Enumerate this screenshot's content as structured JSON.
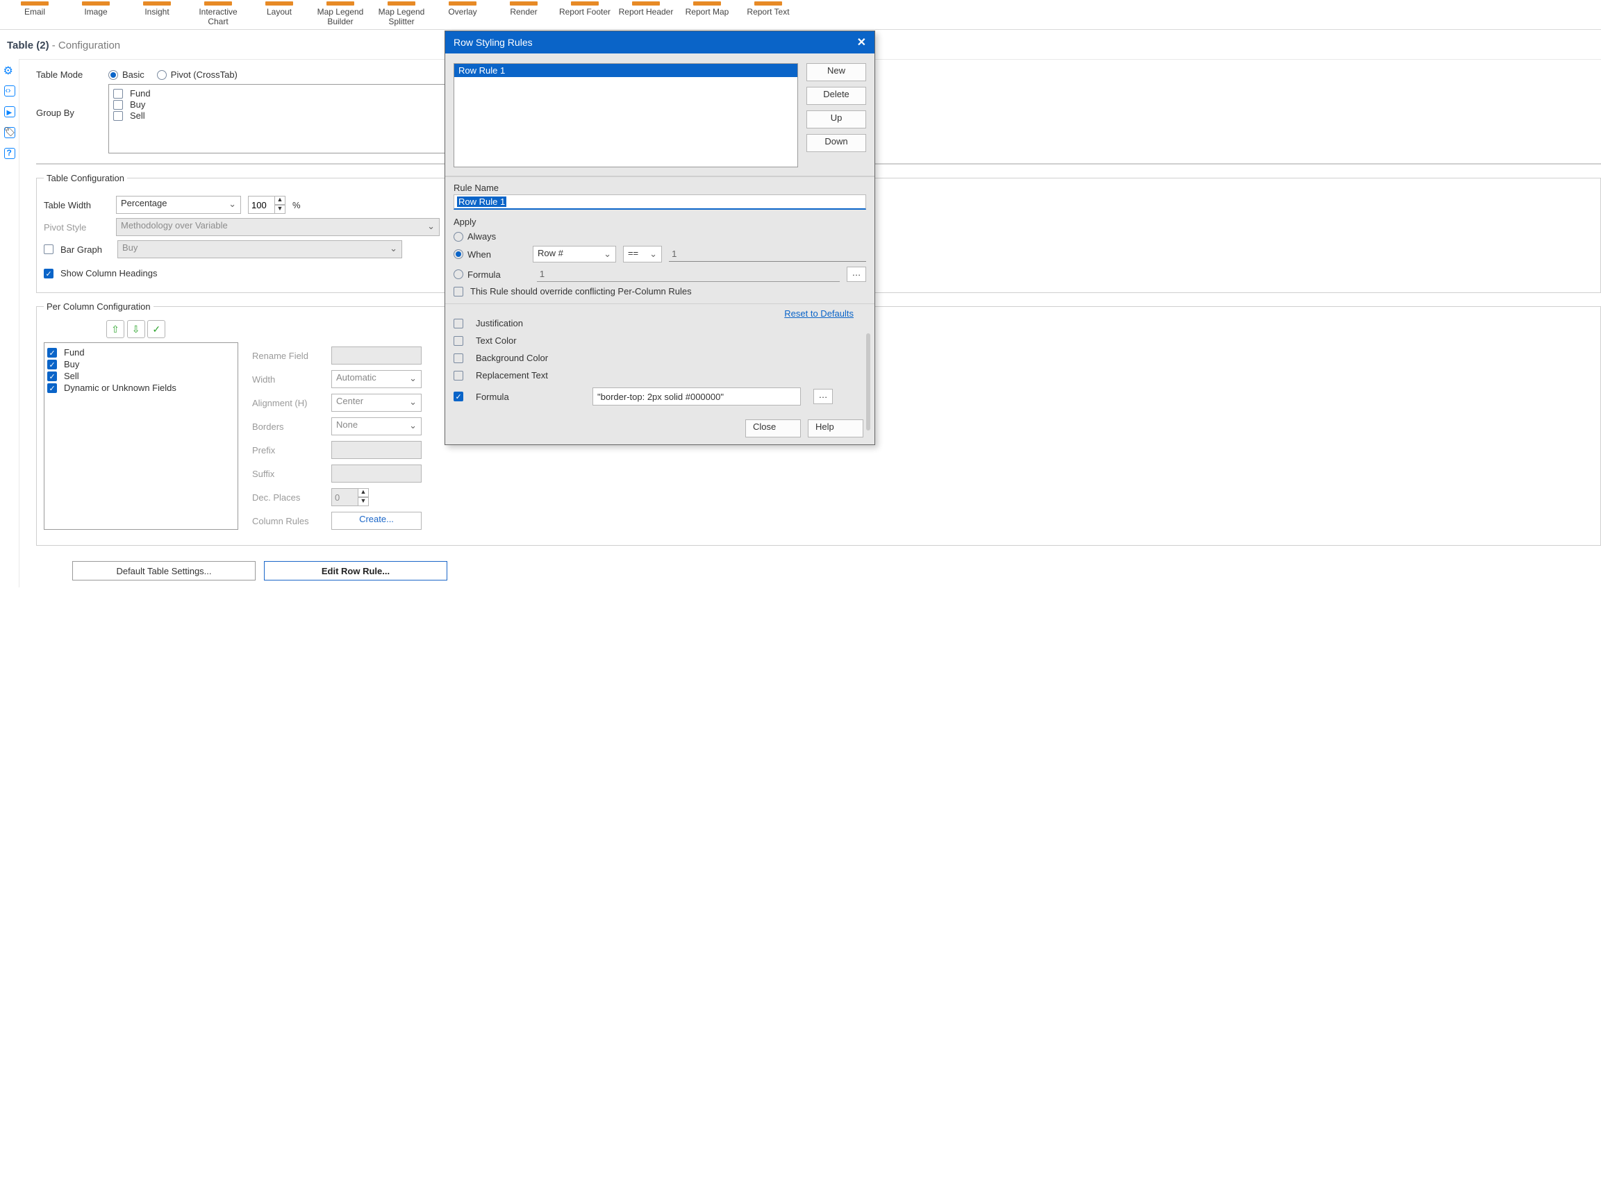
{
  "toolbar": [
    {
      "label": "Email"
    },
    {
      "label": "Image"
    },
    {
      "label": "Insight"
    },
    {
      "label": "Interactive Chart"
    },
    {
      "label": "Layout"
    },
    {
      "label": "Map Legend Builder"
    },
    {
      "label": "Map Legend Splitter"
    },
    {
      "label": "Overlay"
    },
    {
      "label": "Render"
    },
    {
      "label": "Report Footer"
    },
    {
      "label": "Report Header"
    },
    {
      "label": "Report Map"
    },
    {
      "label": "Report Text"
    }
  ],
  "crumb": {
    "tool": "Table (2)",
    "tail": " - Configuration"
  },
  "config": {
    "table_mode_label": "Table Mode",
    "mode_basic": "Basic",
    "mode_pivot": "Pivot (CrossTab)",
    "group_by_label": "Group By",
    "group_by_items": [
      "Fund",
      "Buy",
      "Sell"
    ],
    "table_cfg_legend": "Table Configuration",
    "table_width_label": "Table Width",
    "table_width_mode": "Percentage",
    "table_width_value": "100",
    "table_width_pct": "%",
    "pivot_style_label": "Pivot Style",
    "pivot_style_value": "Methodology over Variable",
    "bar_graph_label": "Bar Graph",
    "bar_graph_field": "Buy",
    "show_headings_label": "Show Column Headings",
    "per_col_legend": "Per Column Configuration",
    "columns": [
      "Fund",
      "Buy",
      "Sell",
      "Dynamic or Unknown Fields"
    ],
    "rename_label": "Rename Field",
    "width_label": "Width",
    "width_value": "Automatic",
    "align_label": "Alignment (H)",
    "align_value": "Center",
    "borders_label": "Borders",
    "borders_value": "None",
    "prefix_label": "Prefix",
    "suffix_label": "Suffix",
    "dec_label": "Dec. Places",
    "dec_value": "0",
    "colrules_label": "Column Rules",
    "colrules_btn": "Create...",
    "default_btn": "Default Table Settings...",
    "editrow_btn": "Edit Row Rule..."
  },
  "modal": {
    "title": "Row Styling Rules",
    "rules": [
      "Row Rule 1"
    ],
    "side": [
      "New",
      "Delete",
      "Up",
      "Down"
    ],
    "rule_name_label": "Rule Name",
    "rule_name_value": "Row Rule 1",
    "apply_legend": "Apply",
    "apply_always": "Always",
    "apply_when": "When",
    "when_field": "Row #",
    "when_op": "==",
    "when_value": "1",
    "apply_formula": "Formula",
    "apply_formula_value": "1",
    "override_label": "This Rule should override conflicting Per-Column Rules",
    "reset": "Reset to Defaults",
    "style_rows": [
      {
        "label": "Justification",
        "checked": false
      },
      {
        "label": "Text Color",
        "checked": false
      },
      {
        "label": "Background Color",
        "checked": false
      },
      {
        "label": "Replacement Text",
        "checked": false
      },
      {
        "label": "Formula",
        "checked": true,
        "value": "\"border-top: 2px solid #000000\""
      }
    ],
    "close": "Close",
    "help": "Help"
  }
}
